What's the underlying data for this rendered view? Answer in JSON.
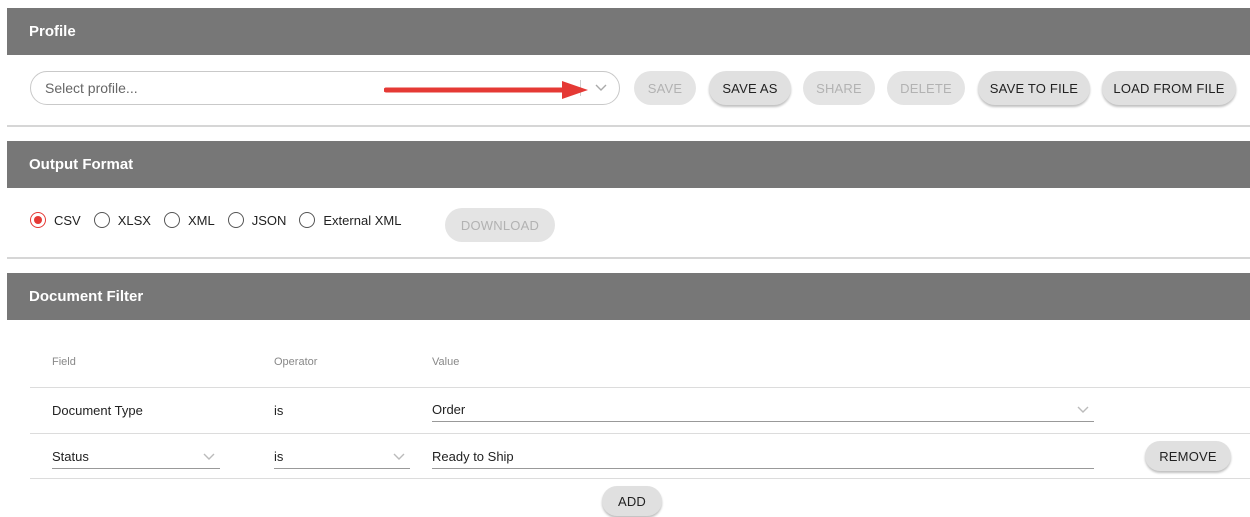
{
  "profile": {
    "header": "Profile",
    "select_placeholder": "Select profile...",
    "buttons": {
      "save": "SAVE",
      "save_as": "SAVE AS",
      "share": "SHARE",
      "delete": "DELETE",
      "save_to_file": "SAVE TO FILE",
      "load_from_file": "LOAD FROM FILE"
    }
  },
  "output_format": {
    "header": "Output Format",
    "options": [
      "CSV",
      "XLSX",
      "XML",
      "JSON",
      "External XML"
    ],
    "selected": "CSV",
    "download": "DOWNLOAD"
  },
  "document_filter": {
    "header": "Document Filter",
    "columns": {
      "field": "Field",
      "operator": "Operator",
      "value": "Value"
    },
    "rows": [
      {
        "field": "Document Type",
        "operator": "is",
        "value": "Order"
      },
      {
        "field": "Status",
        "operator": "is",
        "value": "Ready to Ship",
        "remove": "REMOVE"
      }
    ],
    "add": "ADD"
  },
  "colors": {
    "header_bg": "#777777",
    "accent_red": "#e53935",
    "arrow_red": "#e53935"
  }
}
